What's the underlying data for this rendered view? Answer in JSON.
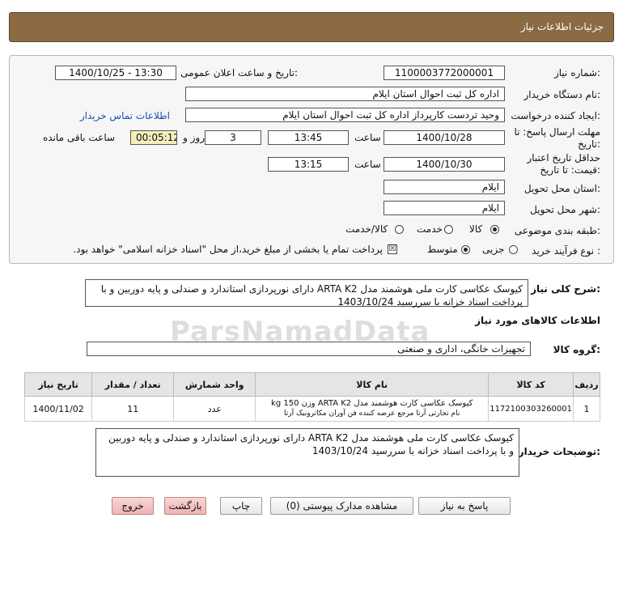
{
  "header": {
    "title": "جزئیات اطلاعات نیاز"
  },
  "form": {
    "need_number_label": "شماره نیاز:",
    "need_number": "1100003772000001",
    "announce_label": "تاریخ و ساعت اعلان عمومی:",
    "announce_value": "1400/10/25 - 13:30",
    "buyer_org_label": "نام دستگاه خریدار:",
    "buyer_org": "اداره کل ثبت احوال استان ایلام",
    "requester_label": "ایجاد کننده درخواست:",
    "requester": "وحید تردست کارپرداز اداره کل ثبت احوال استان ایلام",
    "contact_link": "اطلاعات تماس خریدار",
    "deadline_label_1": "مهلت ارسال پاسخ: تا",
    "deadline_label_2": "تاریخ:",
    "deadline_date": "1400/10/28",
    "time_word": "ساعت",
    "deadline_time": "13:45",
    "days_value": "3",
    "days_word": "روز و",
    "remaining_time": "00:05:12",
    "remaining_label": "ساعت باقی مانده",
    "validity_label_1": "حداقل تاریخ اعتبار",
    "validity_label_2": "قیمت: تا تاریخ:",
    "validity_date": "1400/10/30",
    "validity_time": "13:15",
    "province_label": "استان محل تحویل:",
    "province": "ایلام",
    "city_label": "شهر محل تحویل:",
    "city": "ایلام",
    "category_label": "طبقه بندی موضوعی:",
    "category_options": [
      "کالا",
      "خدمت",
      "کالا/خدمت"
    ],
    "process_label": "نوع فرآیند خرید :",
    "process_options": [
      "جزیی",
      "متوسط"
    ],
    "treasury_note": "پرداخت تمام یا بخشی از مبلغ خرید،از محل \"اسناد خزانه اسلامی\" خواهد بود.",
    "summary_label": "شرح کلی نیاز:",
    "summary_text": "کیوسک عکاسی کارت ملی هوشمند مدل ARTA K2 دارای نورپردازی استاندارد و صندلی و پایه دوربین و با پرداخت اسناد خزانه با سررسید 1403/10/24"
  },
  "goods": {
    "section_title": "اطلاعات کالاهای مورد نیاز",
    "group_label": "گروه کالا:",
    "group_value": "تجهیزات خانگی، اداری و صنعتی",
    "columns": [
      "ردیف",
      "کد کالا",
      "نام کالا",
      "واحد شمارش",
      "تعداد / مقدار",
      "تاریخ نیاز"
    ],
    "rows": [
      {
        "index": "1",
        "code": "1172100303260001",
        "name_line1": "کیوسک عکاسی کارت هوشمند مدل ARTA K2 وزن 150 kg",
        "name_line2": "نام تجارتی آرتا مرجع عرضه کننده فن آوران مکاترونیک آرتا",
        "unit": "عدد",
        "quantity": "11",
        "date": "1400/11/02"
      }
    ]
  },
  "buyer_notes": {
    "label": "توضیحات خریدار:",
    "text": "کیوسک عکاسی کارت ملی هوشمند مدل ARTA K2 دارای نورپردازی استاندارد و صندلی و پایه دوربین و با پرداخت اسناد خزانه با سررسید 1403/10/24"
  },
  "buttons": {
    "reply": "پاسخ به نیاز",
    "attachments": "مشاهده مدارک پیوستی (0)",
    "print": "چاپ",
    "back": "بازگشت",
    "exit": "خروج"
  },
  "watermark": "ParsNamadData"
}
